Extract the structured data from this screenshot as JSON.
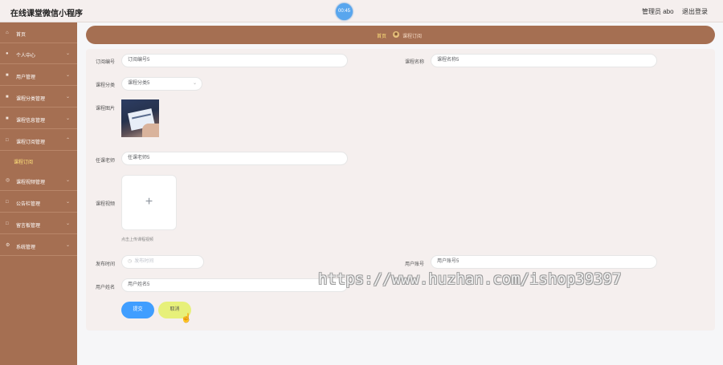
{
  "header": {
    "app_title": "在线课堂微信小程序",
    "timer": "00:45",
    "admin_text": "管理员 abo",
    "logout": "退出登录"
  },
  "sidebar": {
    "items": [
      {
        "label": "首页",
        "icon": "home-icon"
      },
      {
        "label": "个人中心",
        "icon": "user-icon"
      },
      {
        "label": "用户管理",
        "icon": "users-icon"
      },
      {
        "label": "课程分类管理",
        "icon": "category-icon"
      },
      {
        "label": "课程信息管理",
        "icon": "course-icon"
      },
      {
        "label": "课程订阅管理",
        "icon": "subscription-icon"
      },
      {
        "label": "课程订阅",
        "sub": true,
        "active": true
      },
      {
        "label": "课程视频管理",
        "icon": "video-icon"
      },
      {
        "label": "公告栏管理",
        "icon": "notice-icon"
      },
      {
        "label": "留言板管理",
        "icon": "message-icon"
      },
      {
        "label": "系统管理",
        "icon": "settings-icon"
      }
    ]
  },
  "breadcrumb": {
    "home": "首页",
    "current": "课程订阅"
  },
  "form": {
    "order_no": {
      "label": "订阅编号",
      "value": "订阅编号5"
    },
    "course_name": {
      "label": "课程名称",
      "value": "课程名称5"
    },
    "course_category": {
      "label": "课程分类",
      "value": "课程分类5"
    },
    "course_image": {
      "label": "课程图片"
    },
    "teacher": {
      "label": "任课老师",
      "value": "任课老师5"
    },
    "course_video": {
      "label": "课程视频",
      "hint": "点击上传课程视频"
    },
    "publish_time": {
      "label": "发布时间",
      "placeholder": "发布时间"
    },
    "user_account": {
      "label": "用户账号",
      "value": "用户账号5"
    },
    "user_name": {
      "label": "用户姓名",
      "value": "用户姓名5"
    }
  },
  "buttons": {
    "submit": "提交",
    "cancel": "取消"
  },
  "watermark": "https://www.huzhan.com/ishop39397",
  "colors": {
    "sidebar": "#a56f52",
    "accent_yellow": "#ffe27a",
    "primary": "#409eff",
    "cancel": "#e7f07a"
  }
}
